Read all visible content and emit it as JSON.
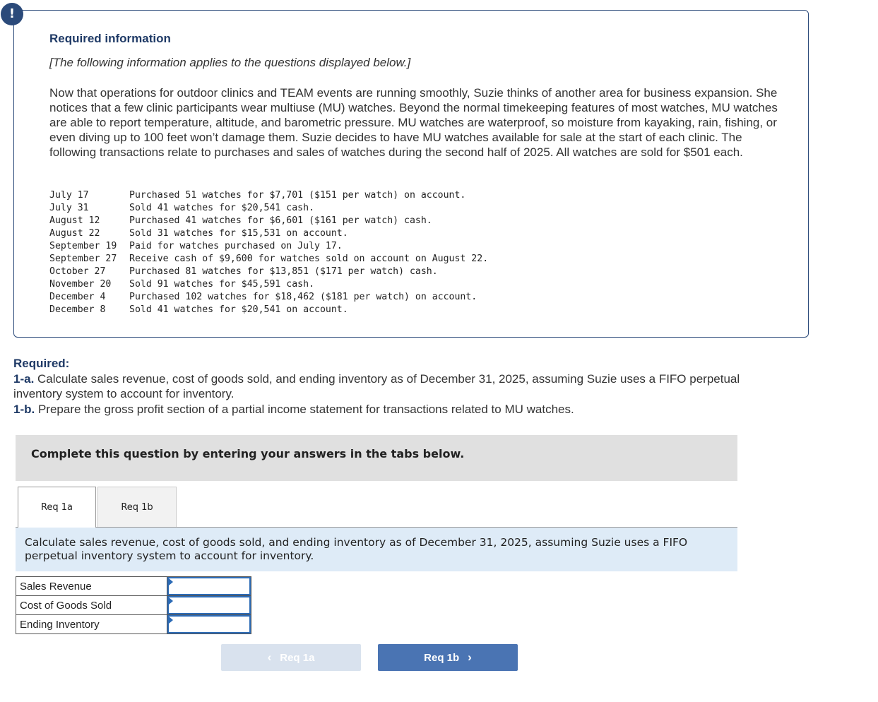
{
  "info": {
    "alert_glyph": "!",
    "title": "Required information",
    "subtitle": "[The following information applies to the questions displayed below.]",
    "intro": "Now that operations for outdoor clinics and TEAM events are running smoothly, Suzie thinks of another area for business expansion. She notices that a few clinic participants wear multiuse (MU) watches. Beyond the normal timekeeping features of most watches, MU watches are able to report temperature, altitude, and barometric pressure. MU watches are waterproof, so moisture from kayaking, rain, fishing, or even diving up to 100 feet won’t damage them. Suzie decides to have MU watches available for sale at the start of each clinic. The following transactions relate to purchases and sales of watches during the second half of 2025. All watches are sold for $501 each.",
    "transactions": [
      {
        "date": "July 17",
        "text": "Purchased 51 watches for $7,701 ($151 per watch) on account."
      },
      {
        "date": "July 31",
        "text": "Sold 41 watches for $20,541 cash."
      },
      {
        "date": "August 12",
        "text": "Purchased 41 watches for $6,601 ($161 per watch) cash."
      },
      {
        "date": "August 22",
        "text": "Sold 31 watches for $15,531 on account."
      },
      {
        "date": "September 19",
        "text": "Paid for watches purchased on July 17."
      },
      {
        "date": "September 27",
        "text": "Receive cash of $9,600 for watches sold on account on August 22."
      },
      {
        "date": "October 27",
        "text": "Purchased 81 watches for $13,851 ($171 per watch) cash."
      },
      {
        "date": "November 20",
        "text": "Sold 91 watches for $45,591 cash."
      },
      {
        "date": "December 4",
        "text": "Purchased 102 watches for $18,462 ($181 per watch) on account."
      },
      {
        "date": "December 8",
        "text": "Sold 41 watches for $20,541 on account."
      }
    ]
  },
  "required": {
    "heading": "Required:",
    "items": [
      {
        "label": "1-a.",
        "text": " Calculate sales revenue, cost of goods sold, and ending inventory as of December 31, 2025, assuming Suzie uses a FIFO perpetual inventory system to account for inventory."
      },
      {
        "label": "1-b.",
        "text": " Prepare the gross profit section of a partial income statement for transactions related to MU watches."
      }
    ]
  },
  "complete_bar": "Complete this question by entering your answers in the tabs below.",
  "tabs": [
    {
      "label": "Req 1a",
      "active": true
    },
    {
      "label": "Req 1b",
      "active": false
    }
  ],
  "instruction": "Calculate sales revenue, cost of goods sold, and ending inventory as of December 31, 2025, assuming Suzie uses a FIFO perpetual inventory system to account for inventory.",
  "answer_rows": [
    {
      "label": "Sales Revenue",
      "value": ""
    },
    {
      "label": "Cost of Goods Sold",
      "value": ""
    },
    {
      "label": "Ending Inventory",
      "value": ""
    }
  ],
  "nav": {
    "prev_label": "Req 1a",
    "next_label": "Req 1b",
    "prev_icon": "‹",
    "next_icon": "›"
  },
  "colors": {
    "accent": "#2b4a7a",
    "next_button": "#4a74b3",
    "prev_button_disabled": "#d9e2ee",
    "instruction_bg": "#deebf7"
  }
}
